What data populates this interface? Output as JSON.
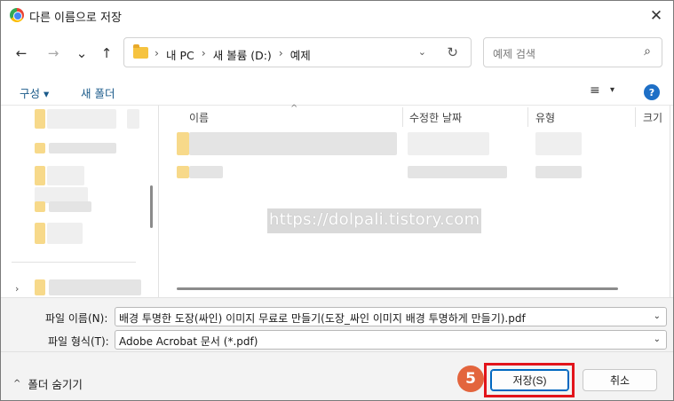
{
  "window": {
    "title": "다른 이름으로 저장",
    "close_glyph": "✕"
  },
  "nav": {
    "back_glyph": "←",
    "forward_glyph": "→",
    "recent_glyph": "⌄",
    "up_glyph": "↑",
    "breadcrumb": [
      "내 PC",
      "새 볼륨 (D:)",
      "예제"
    ],
    "breadcrumb_sep": "›",
    "dropdown_glyph": "⌄",
    "refresh_glyph": "↻",
    "search_placeholder": "예제 검색",
    "search_glyph": "⌕"
  },
  "toolbar": {
    "organize_label": "구성 ▾",
    "new_folder_label": "새 폴더",
    "view_glyph": "≡",
    "view_drop_glyph": "▾",
    "help_glyph": "?"
  },
  "file_list": {
    "columns": [
      "이름",
      "수정한 날짜",
      "유형",
      "크기"
    ],
    "sort_glyph": "^",
    "watermark": "https://dolpali.tistory.com"
  },
  "save_form": {
    "filename_label": "파일 이름(N):",
    "filename_value": "배경 투명한 도장(싸인) 이미지 무료로 만들기(도장_싸인 이미지 배경 투명하게 만들기).pdf",
    "filetype_label": "파일 형식(T):",
    "filetype_value": "Adobe Acrobat 문서 (*.pdf)",
    "dropdown_glyph": "⌄"
  },
  "footer": {
    "hide_folders_label": "폴더 숨기기",
    "hide_chevron": "^",
    "step_number": "5",
    "save_label": "저장(S)",
    "cancel_label": "취소"
  },
  "colors": {
    "accent": "#0067c0",
    "highlight": "#e2141b",
    "badge": "#e3653d"
  }
}
